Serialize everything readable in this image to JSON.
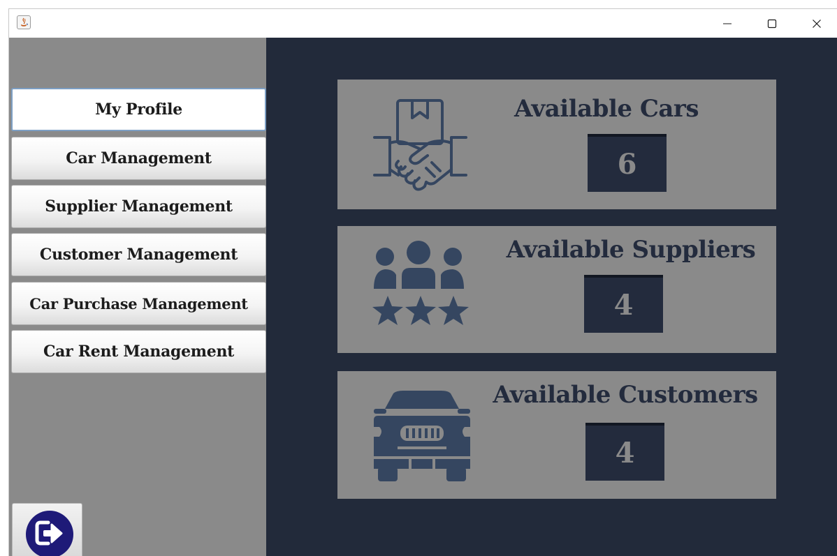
{
  "window": {
    "minimize_glyph": "─",
    "maximize_glyph": "☐",
    "close_glyph": "✕"
  },
  "sidebar": {
    "items": [
      {
        "label": "My Profile",
        "active": true
      },
      {
        "label": "Car Management"
      },
      {
        "label": "Supplier Management"
      },
      {
        "label": "Customer Management"
      },
      {
        "label": "Car Purchase Management"
      },
      {
        "label": "Car Rent Management"
      }
    ],
    "logout_icon": "logout-icon"
  },
  "cards": [
    {
      "title": "Available Cars",
      "count": "6",
      "icon": "handshake-package-icon"
    },
    {
      "title": "Available Suppliers",
      "count": "4",
      "icon": "team-rating-icon"
    },
    {
      "title": "Available Customers",
      "count": "4",
      "icon": "car-front-icon"
    }
  ],
  "colors": {
    "sidebar_bg": "#8a8a8a",
    "main_bg": "#222a3a",
    "card_bg": "#8a8a8a",
    "icon_color": "#354660",
    "count_box_bg": "#232b3d",
    "logout_bg": "#1e1a78",
    "active_border": "#7d9fc4"
  }
}
